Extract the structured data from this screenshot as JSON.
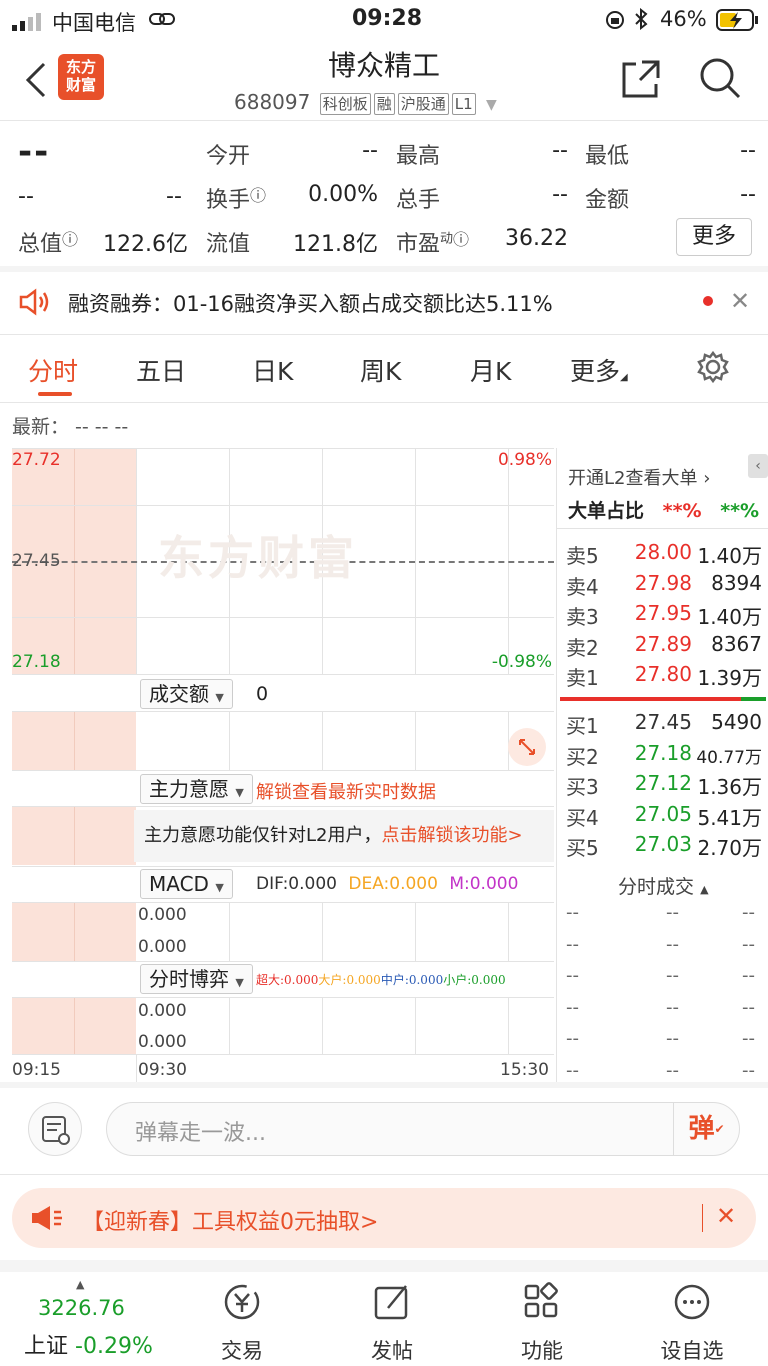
{
  "status": {
    "carrier": "中国电信",
    "time": "09:28",
    "battery": "46%"
  },
  "header": {
    "logo": "东方财富",
    "title": "博众精工",
    "code": "688097",
    "tags": [
      "科创板",
      "融",
      "沪股通",
      "L1"
    ]
  },
  "quote": {
    "price": "--",
    "change": "--",
    "change_pct": "--",
    "rows": [
      [
        {
          "label": "今开",
          "value": "--"
        },
        {
          "label": "最高",
          "value": "--"
        },
        {
          "label": "最低",
          "value": "--"
        }
      ],
      [
        {
          "label": "换手",
          "value": "0.00%"
        },
        {
          "label": "总手",
          "value": "--"
        },
        {
          "label": "金额",
          "value": "--"
        }
      ],
      [
        {
          "label": "总值",
          "value": "122.6亿"
        },
        {
          "label": "流值",
          "value": "121.8亿"
        },
        {
          "label": "市盈",
          "sup": "动",
          "value": "36.22"
        }
      ]
    ],
    "more_label": "更多"
  },
  "notice": {
    "text": "融资融券：01-16融资净买入额占成交额比达5.11%"
  },
  "tabs": [
    "分时",
    "五日",
    "日K",
    "周K",
    "月K",
    "更多"
  ],
  "active_tab": "分时",
  "latest_label": "最新：",
  "latest_values": "--  --  --",
  "chart": {
    "high_price": "27.72",
    "mid_price": "27.45",
    "low_price": "27.18",
    "high_pct": "0.98%",
    "low_pct": "-0.98%",
    "watermark": "东方财富",
    "volume_select": "成交额",
    "volume_value": "0",
    "main_select": "主力意愿",
    "main_unlock": "解锁查看最新实时数据",
    "main_msg": "主力意愿功能仅针对L2用户，",
    "main_msg_link": "点击解锁该功能>",
    "macd_select": "MACD",
    "macd_dif": "DIF:0.000",
    "macd_dea": "DEA:0.000",
    "macd_m": "M:0.000",
    "macd_top": "0.000",
    "macd_bottom": "0.000",
    "game_select": "分时博弈",
    "game_items": [
      {
        "label": "超大:0.000",
        "color": "#e8302a"
      },
      {
        "label": "大户:0.000",
        "color": "#f5a623"
      },
      {
        "label": "中户:0.000",
        "color": "#2a5ab5"
      },
      {
        "label": "小户:0.000",
        "color": "#1a9e2a"
      }
    ],
    "game_top": "0.000",
    "game_bottom": "0.000",
    "times": [
      "09:15",
      "09:30",
      "15:30"
    ]
  },
  "orderbook": {
    "l2_link": "开通L2查看大单",
    "big_ratio_label": "大单占比",
    "big_red": "**%",
    "big_green": "**%",
    "asks": [
      {
        "label": "卖5",
        "price": "28.00",
        "vol": "1.40万"
      },
      {
        "label": "卖4",
        "price": "27.98",
        "vol": "8394"
      },
      {
        "label": "卖3",
        "price": "27.95",
        "vol": "1.40万"
      },
      {
        "label": "卖2",
        "price": "27.89",
        "vol": "8367"
      },
      {
        "label": "卖1",
        "price": "27.80",
        "vol": "1.39万"
      }
    ],
    "bids": [
      {
        "label": "买1",
        "price": "27.45",
        "vol": "5490"
      },
      {
        "label": "买2",
        "price": "27.18",
        "vol": "40.77万"
      },
      {
        "label": "买3",
        "price": "27.12",
        "vol": "1.36万"
      },
      {
        "label": "买4",
        "price": "27.05",
        "vol": "5.41万"
      },
      {
        "label": "买5",
        "price": "27.03",
        "vol": "2.70万"
      }
    ],
    "trades_label": "分时成交"
  },
  "danmaku": {
    "placeholder": "弹幕走一波...",
    "send": "弹"
  },
  "promo": {
    "text": "【迎新春】工具权益0元抽取>"
  },
  "bottom": {
    "index_value": "3226.76",
    "index_name": "上证",
    "index_change": "-0.29%",
    "nav": [
      "交易",
      "发帖",
      "功能",
      "设自选"
    ]
  }
}
